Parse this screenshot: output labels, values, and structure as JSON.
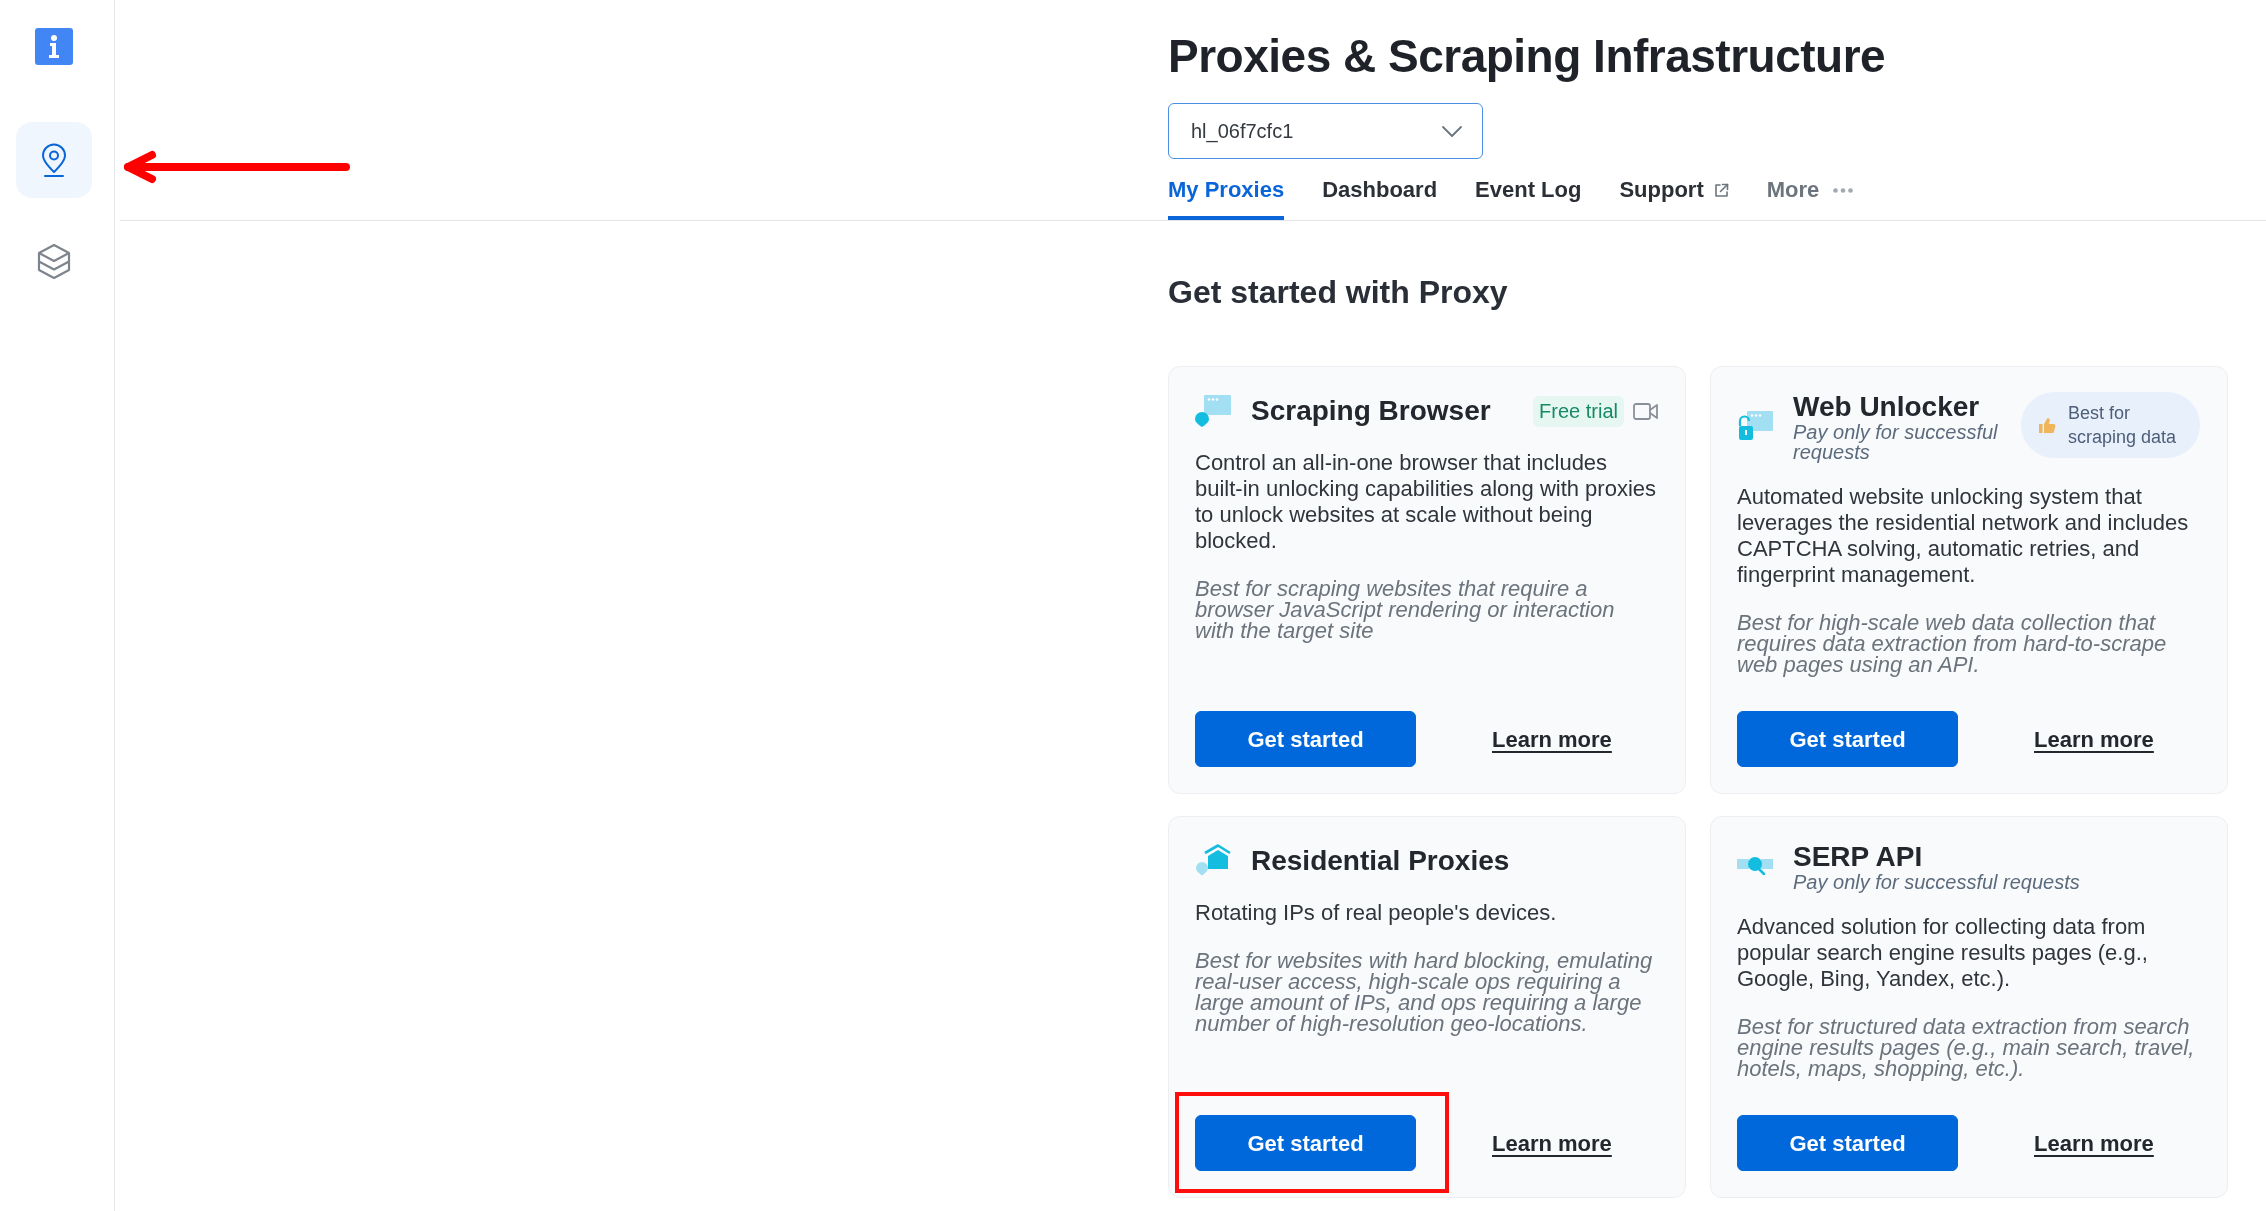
{
  "sidebar": {
    "items": [
      {
        "selected": true,
        "annotated": true
      },
      {
        "selected": false,
        "annotated": false
      }
    ]
  },
  "header": {
    "title": "Proxies & Scraping Infrastructure",
    "zone_select": {
      "value": "hl_06f7cfc1"
    },
    "tabs": [
      {
        "label": "My Proxies",
        "selected": true,
        "kind": "page"
      },
      {
        "label": "Dashboard",
        "selected": false,
        "kind": "page"
      },
      {
        "label": "Event Log",
        "selected": false,
        "kind": "page"
      },
      {
        "label": "Support",
        "selected": false,
        "kind": "external"
      },
      {
        "label": "More",
        "selected": false,
        "kind": "menu"
      }
    ]
  },
  "section_title": "Get started with Proxy",
  "cards": [
    {
      "title": "Scraping Browser",
      "badge": {
        "kind": "trial",
        "label": "Free trial"
      },
      "video": true,
      "description": "Control an all-in-one browser that includes built-in unlocking capabilities along with proxies to unlock websites at scale without being blocked.",
      "best_for": "Best for scraping websites that require a browser JavaScript rendering or interaction with the target site",
      "primary_button": "Get started",
      "link": "Learn more",
      "button_annotated": false
    },
    {
      "title": "Web Unlocker",
      "subtitle": "Pay only for successful requests",
      "badge": {
        "kind": "recommended",
        "label": "Best for scraping data"
      },
      "video": false,
      "description": "Automated website unlocking system that leverages the residential network and includes CAPTCHA solving, automatic retries, and fingerprint management.",
      "best_for": "Best for high-scale web data collection that requires data extraction from hard-to-scrape web pages using an API.",
      "primary_button": "Get started",
      "link": "Learn more",
      "button_annotated": false
    },
    {
      "title": "Residential Proxies",
      "video": false,
      "description": "Rotating IPs of real people's devices.",
      "best_for": "Best for websites with hard blocking, emulating real-user access, high-scale ops requiring a large amount of IPs, and ops requiring a large number of high-resolution geo-locations.",
      "primary_button": "Get started",
      "link": "Learn more",
      "button_annotated": true
    },
    {
      "title": "SERP API",
      "subtitle": "Pay only for successful requests",
      "video": false,
      "description": "Advanced solution for collecting data from popular search engine results pages (e.g., Google, Bing, Yandex, etc.).",
      "best_for": "Best for structured data extraction from search engine results pages (e.g., main search, travel, hotels, maps, shopping, etc.).",
      "primary_button": "Get started",
      "link": "Learn more",
      "button_annotated": false
    }
  ]
}
